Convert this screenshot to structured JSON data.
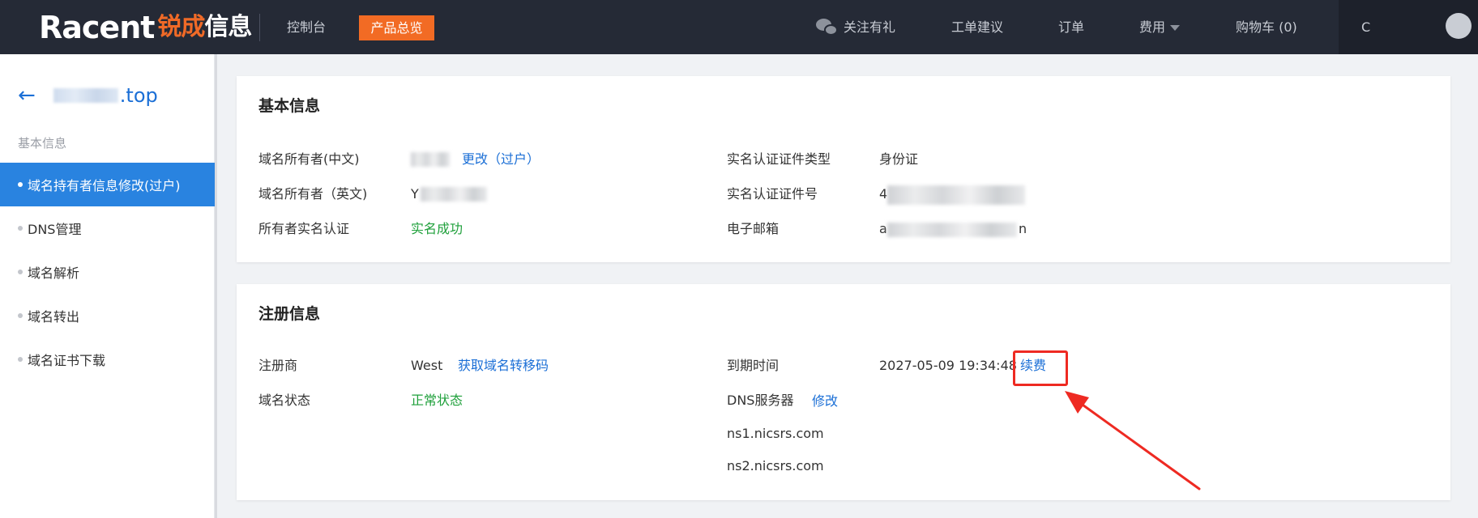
{
  "header": {
    "logo_en": "Racent",
    "logo_cn_accent": "锐成",
    "logo_cn_rest": "信息",
    "nav_console": "控制台",
    "nav_products": "产品总览",
    "nav_wechat": "关注有礼",
    "nav_ticket": "工单建议",
    "nav_order": "订单",
    "nav_fee": "费用",
    "nav_cart": "购物车 (0)",
    "user_initial": "C"
  },
  "sidebar": {
    "domain_tld": ".top",
    "section_label": "基本信息",
    "items": [
      {
        "label": "域名持有者信息修改(过户)",
        "active": true
      },
      {
        "label": "DNS管理",
        "active": false
      },
      {
        "label": "域名解析",
        "active": false
      },
      {
        "label": "域名转出",
        "active": false
      },
      {
        "label": "域名证书下载",
        "active": false
      }
    ]
  },
  "basic_info": {
    "title": "基本信息",
    "owner_cn_label": "域名所有者(中文)",
    "owner_cn_change": "更改（过户）",
    "owner_en_label": "域名所有者（英文)",
    "owner_en_initial": "Y",
    "realname_label": "所有者实名认证",
    "realname_value": "实名成功",
    "cert_type_label": "实名认证证件类型",
    "cert_type_value": "身份证",
    "cert_no_label": "实名认证证件号",
    "cert_no_initial": "4",
    "email_label": "电子邮箱",
    "email_initial": "a",
    "email_tail": "n"
  },
  "registration_info": {
    "title": "注册信息",
    "registrar_label": "注册商",
    "registrar_value": "West",
    "transfer_code_link": "获取域名转移码",
    "status_label": "域名状态",
    "status_value": "正常状态",
    "expiry_label": "到期时间",
    "expiry_value": "2027-05-09 19:34:48",
    "renew_link": "续费",
    "dns_label": "DNS服务器",
    "dns_modify_link": "修改",
    "dns_servers": [
      "ns1.nicsrs.com",
      "ns2.nicsrs.com"
    ]
  },
  "colors": {
    "topbar": "#252a36",
    "brand_orange": "#f26b24",
    "active_blue": "#2983e0",
    "link_blue": "#1b6fd6",
    "success_green": "#1fa03b",
    "annotation_red": "#ee2a22"
  }
}
